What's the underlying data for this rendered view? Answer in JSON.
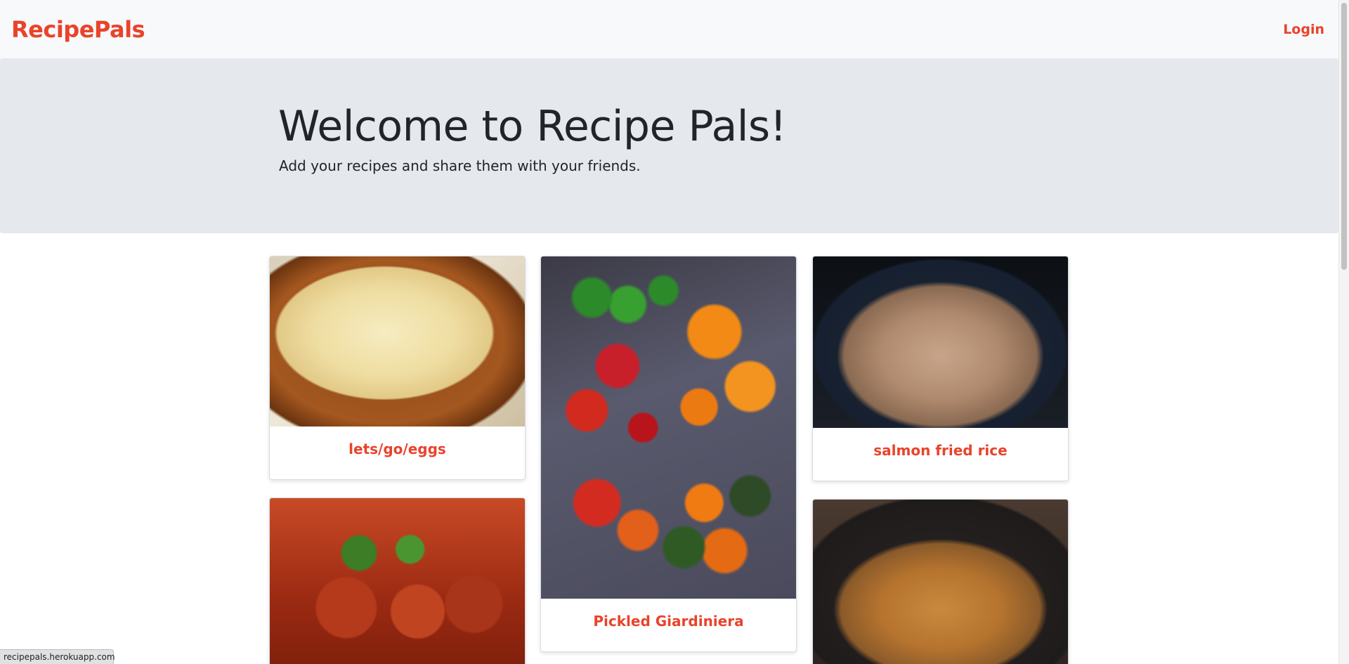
{
  "navbar": {
    "brand": "RecipePals",
    "login_label": "Login"
  },
  "hero": {
    "title": "Welcome to Recipe Pals!",
    "subtitle": "Add your recipes and share them with your friends."
  },
  "recipes": [
    {
      "title": "lets/go/eggs",
      "image": "mashed potatoes in bowl"
    },
    {
      "title": "Pickled Giardiniera",
      "image": "sliced peppers"
    },
    {
      "title": "salmon fried rice",
      "image": "fried rice in pan"
    },
    {
      "title": "",
      "image": "shrimp curry"
    },
    {
      "title": "",
      "image": "stir-fried noodles in wok"
    }
  ],
  "status_bar": {
    "url": "recipepals.herokuapp.com"
  },
  "colors": {
    "accent": "#e9432b",
    "navbar_bg": "#f8f9fa",
    "hero_bg": "#e5e8ec"
  }
}
